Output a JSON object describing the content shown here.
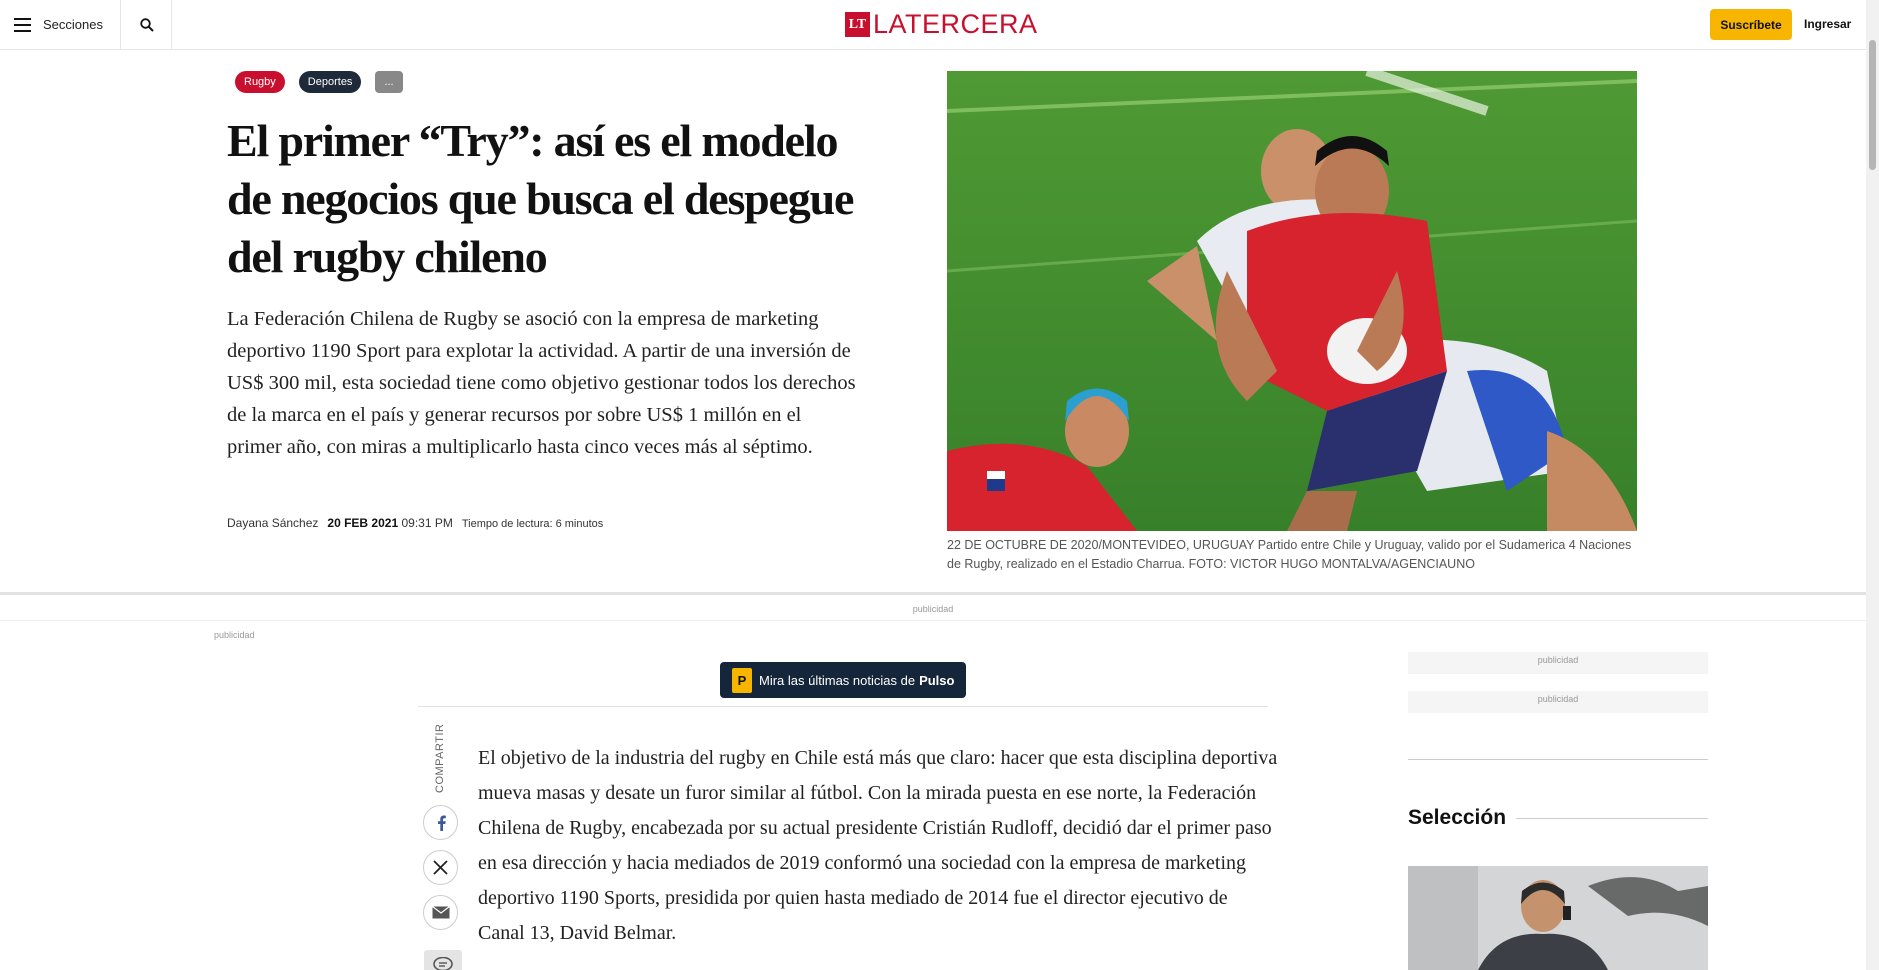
{
  "header": {
    "menu_label": "Secciones",
    "logo_mark": "LT",
    "logo_text": "LATERCERA",
    "subscribe_label": "Suscríbete",
    "login_label": "Ingresar"
  },
  "article": {
    "tags": [
      "Rugby",
      "Deportes",
      "..."
    ],
    "headline": "El primer “Try”: así es el modelo de negocios que busca el despegue del rugby chileno",
    "lead": "La Federación Chilena de Rugby se asoció con la empresa de marketing deportivo 1190 Sport para explotar la actividad. A partir de una inversión de US$ 300 mil, esta sociedad tiene como objetivo gestionar todos los derechos de la marca en el país y generar recursos por sobre US$ 1 millón en el primer año, con miras a multiplicarlo hasta cinco veces más al séptimo.",
    "author": "Dayana Sánchez",
    "date": "20 FEB 2021",
    "time": "09:31 PM",
    "reading_time": "Tiempo de lectura: 6 minutos",
    "image_caption": "22 DE OCTUBRE DE 2020/MONTEVIDEO, URUGUAY Partido entre Chile y Uruguay, valido por el Sudamerica 4 Naciones de Rugby, realizado en el Estadio Charrua. FOTO: VICTOR HUGO MONTALVA/AGENCIAUNO",
    "body_paragraph": "El objetivo de la industria del rugby en Chile está más que claro: hacer que esta disciplina deportiva mueva masas y desate un furor similar al fútbol. Con la mirada puesta en ese norte, la Federación Chilena de Rugby, encabezada por su actual presidente Cristián Rudloff, decidió dar el primer paso en esa dirección y hacia mediados de 2019 conformó una sociedad con la empresa de marketing deportivo 1190 Sports, presidida por quien hasta mediado de 2014 fue el director ejecutivo de Canal 13, David Belmar."
  },
  "ads": {
    "label": "publicidad"
  },
  "pulso_banner": {
    "icon": "P",
    "text": "Mira las últimas noticias de",
    "brand": "Pulso"
  },
  "share": {
    "label": "COMPARTIR",
    "icons": [
      "facebook-icon",
      "x-icon",
      "mail-icon",
      "comment-icon"
    ]
  },
  "sidebar": {
    "section_title": "Selección"
  },
  "colors": {
    "brand_red": "#c8102e",
    "subscribe_yellow": "#f7b500",
    "navy": "#15263a"
  }
}
